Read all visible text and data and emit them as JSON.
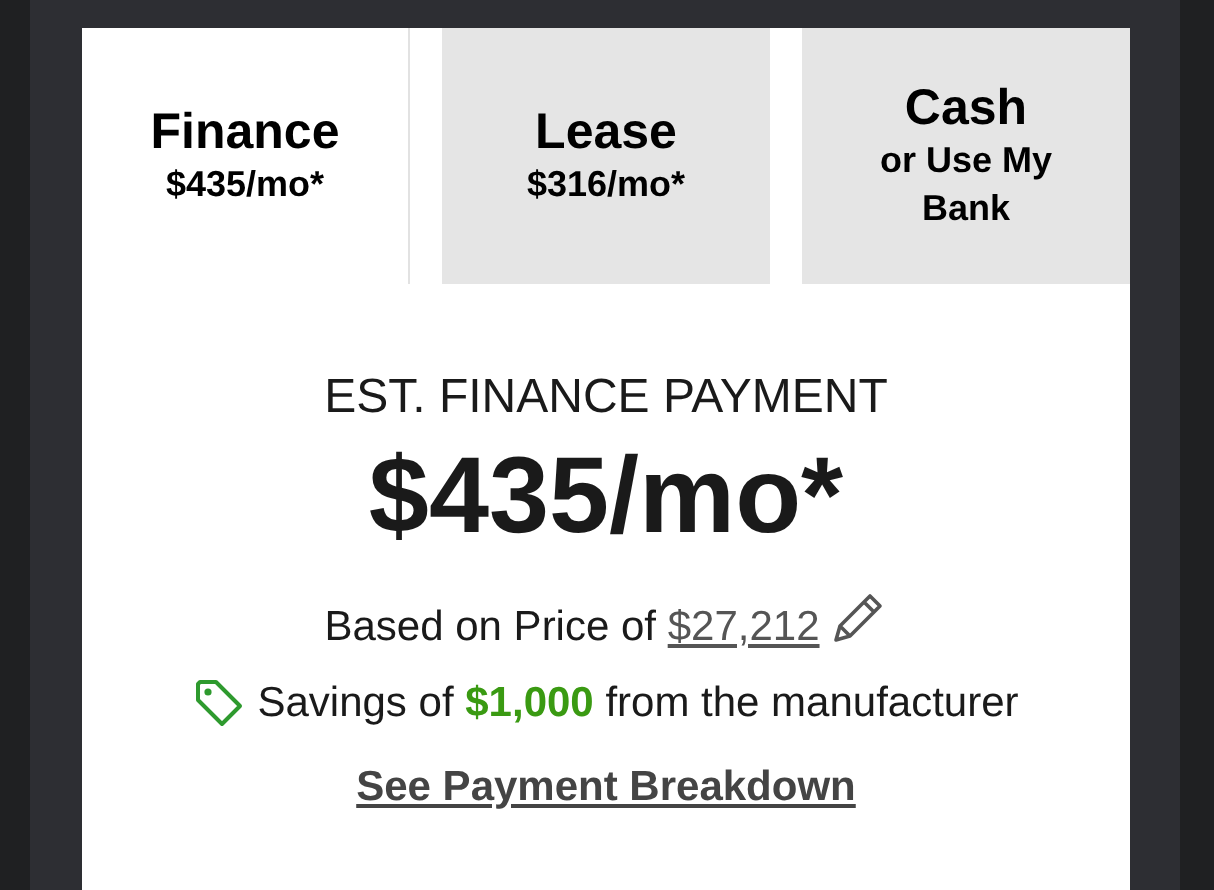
{
  "tabs": [
    {
      "label": "Finance",
      "sublabel": "$435/mo*",
      "selected": true
    },
    {
      "label": "Lease",
      "sublabel": "$316/mo*",
      "selected": false
    },
    {
      "label": "Cash",
      "sublabel": "or Use My Bank",
      "selected": false
    }
  ],
  "payment": {
    "heading": "EST. FINANCE PAYMENT",
    "amount": "$435/mo*",
    "price_prefix": "Based on Price of",
    "price": "$27,212",
    "savings": "Savings of **$1,000** from the manufacturer",
    "breakdown_link": "See Payment Breakdown"
  }
}
